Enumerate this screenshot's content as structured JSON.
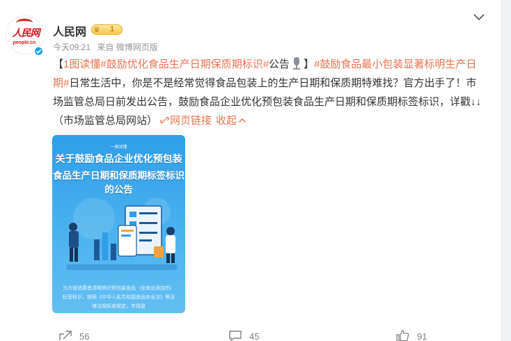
{
  "author": {
    "name": "人民网",
    "logo_text": "人民网",
    "logo_sub": "people.cn",
    "badge_level": "1"
  },
  "meta": {
    "time": "今天09:21",
    "source": "来自 微博网页版"
  },
  "post": {
    "open_bracket": "【",
    "tag1": "1图读懂",
    "tag2": "#鼓励优化食品生产日期保质期标识#",
    "tag2_suffix": "公告",
    "close_bracket": "】",
    "tag3": "#鼓励食品最小包装显著标明生产日期#",
    "body": "日常生活中，你是不是经常觉得食品包装上的生产日期和保质期特难找？官方出手了！市场监管总局日前发出公告，鼓励食品企业优化预包装食品生产日期和保质期标签标识，详戳↓↓（市场监管总局网站）",
    "link_text": "网页链接",
    "collapse_text": "收起"
  },
  "image": {
    "kicker": "一图读懂",
    "title_line1": "关于鼓励食品企业优化预包装",
    "title_line2": "食品生产日期和保质期标签标识的公告",
    "caption": "为方便消费者清晰辨识预包装食品（含食品添加剂）标签标识，按照《中华人民共和国食品安全法》等法律法规标准规定，市场监"
  },
  "actions": {
    "share_count": "56",
    "comment_count": "45",
    "like_count": "91"
  },
  "colors": {
    "accent": "#eb7350",
    "brand_red": "#d4161b",
    "verified_blue": "#1da1f2"
  },
  "icons": [
    "chevron-down-icon",
    "verified-icon",
    "crown-icon",
    "microphone-icon",
    "link-icon",
    "chevron-up-icon",
    "share-icon",
    "comment-icon",
    "like-icon"
  ]
}
